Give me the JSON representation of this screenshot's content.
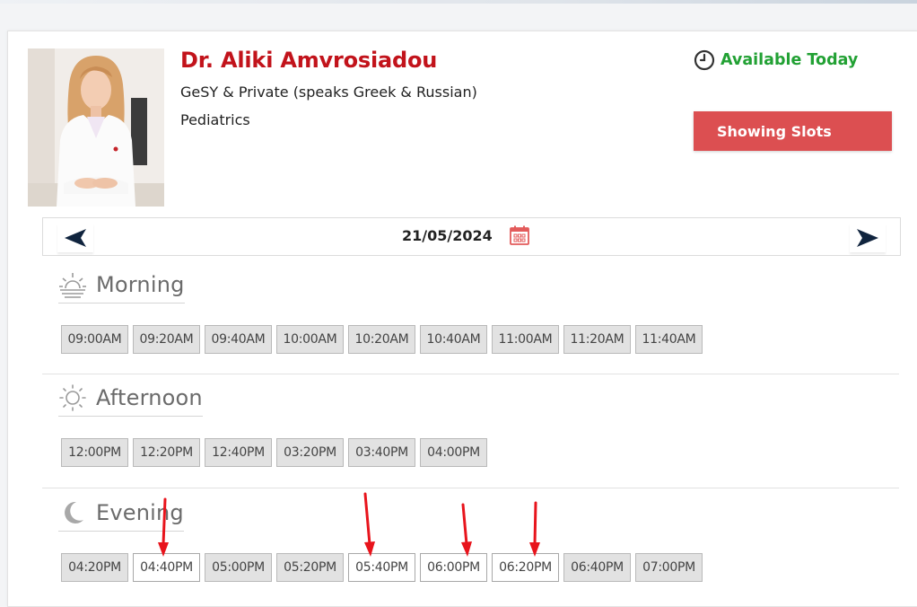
{
  "doctor": {
    "name": "Dr. Aliki Amvrosiadou",
    "insurance": "GeSY & Private (speaks Greek & Russian)",
    "specialty": "Pediatrics"
  },
  "availability": {
    "label": "Available Today",
    "color": "#22a134",
    "icon": "clock-icon"
  },
  "action_button": {
    "label": "Showing Slots",
    "color": "#dc4f51"
  },
  "date_nav": {
    "date": "21/05/2024",
    "prev_icon": "arrow-left-icon",
    "next_icon": "arrow-right-icon",
    "calendar_icon": "calendar-icon"
  },
  "sections": {
    "morning": {
      "title": "Morning",
      "icon": "sunrise-icon",
      "slots": [
        "09:00AM",
        "09:20AM",
        "09:40AM",
        "10:00AM",
        "10:20AM",
        "10:40AM",
        "11:00AM",
        "11:20AM",
        "11:40AM"
      ]
    },
    "afternoon": {
      "title": "Afternoon",
      "icon": "sun-icon",
      "slots": [
        "12:00PM",
        "12:20PM",
        "12:40PM",
        "03:20PM",
        "03:40PM",
        "04:00PM"
      ]
    },
    "evening": {
      "title": "Evening",
      "icon": "moon-icon",
      "slots": [
        "04:20PM",
        "04:40PM",
        "05:00PM",
        "05:20PM",
        "05:40PM",
        "06:00PM",
        "06:20PM",
        "06:40PM",
        "07:00PM"
      ],
      "highlighted": [
        "04:40PM",
        "05:40PM",
        "06:00PM",
        "06:20PM"
      ]
    }
  },
  "annotation_color": "#e8141c"
}
